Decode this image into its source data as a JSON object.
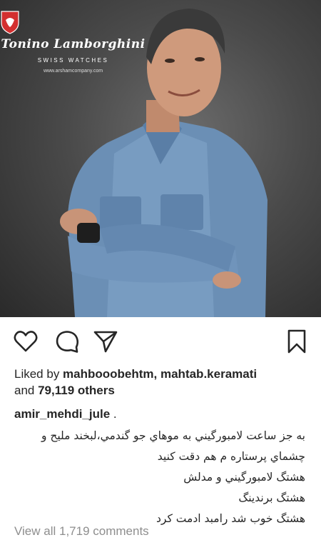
{
  "brand": {
    "name": "Tonino Lamborghini",
    "tagline": "SWISS WATCHES",
    "url": "www.arshamcompany.com"
  },
  "actions": {
    "like_icon": "heart-icon",
    "comment_icon": "comment-icon",
    "share_icon": "paper-plane-icon",
    "save_icon": "bookmark-icon"
  },
  "likes": {
    "prefix": "Liked by ",
    "users": "mahbooobehtm, mahtab.keramati",
    "and": "and ",
    "others": "79,119 others"
  },
  "post": {
    "username": "amir_mehdi_jule",
    "dot": " .",
    "caption_lines": [
      "به جز ساعت لامبورگيني به موهاي جو گندمي،لبخند مليح و",
      "چشماي پرستاره م هم دقت کنيد",
      "هشتگ لامبورگيني و مدلش",
      "هشتگ برندينگ",
      "هشتگ خوب شد رامبد ادمت کرد"
    ]
  },
  "comments": {
    "view_all": "View all 1,719 comments"
  }
}
